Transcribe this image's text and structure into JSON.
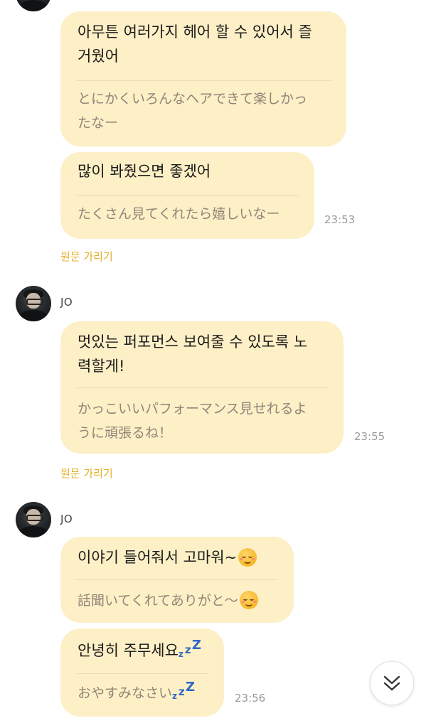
{
  "messages": [
    {
      "original": [
        "아무튼 여러가지 헤어 할 수 있어서 즐",
        "거웠어"
      ],
      "translation": [
        "とにかくいろんなヘアできて楽しかっ",
        "たなー"
      ]
    },
    {
      "original": [
        "많이 봐줬으면 좋겠어"
      ],
      "translation": [
        "たくさん見てくれたら嬉しいなー"
      ],
      "time": "23:53"
    },
    {
      "sender": "JO",
      "original": [
        "멋있는 퍼포먼스 보여줄 수 있도록 노",
        "력할게!"
      ],
      "translation": [
        "かっこいいパフォーマンス見せれるよ",
        "うに頑張るね！"
      ],
      "time": "23:55"
    },
    {
      "sender": "JO",
      "original": [
        "이야기 들어줘서 고마워~"
      ],
      "original_emoji": "smiling-face-emoji",
      "translation": [
        "話聞いてくれてありがと～"
      ],
      "translation_emoji": "smiling-face-emoji"
    },
    {
      "original": [
        "안녕히 주무세요"
      ],
      "original_emoji": "zzz-emoji",
      "translation": [
        "おやすみなさい"
      ],
      "translation_emoji": "zzz-emoji",
      "time": "23:56"
    }
  ],
  "hide_original_label": "원문 가리기",
  "scroll_down_icon": "double-chevron-down-icon",
  "colors": {
    "bubble": "#fdefc6",
    "divider": "#ecdcae",
    "accent": "#e2b128",
    "translation_text": "#8f8678",
    "time_text": "#9a9a9a"
  }
}
